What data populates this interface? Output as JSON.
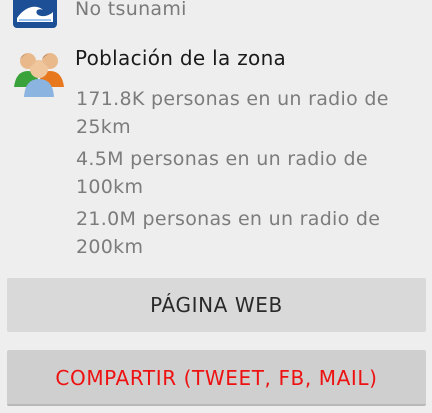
{
  "tsunami": {
    "text": "No tsunami",
    "icon": "tsunami-wave-icon"
  },
  "population": {
    "icon": "people-group-icon",
    "title": "Población de la zona",
    "items": [
      "171.8K personas en un radio de 25km",
      "4.5M personas en un radio de 100km",
      "21.0M personas en un radio de 200km"
    ]
  },
  "buttons": {
    "web_label": "PÁGINA WEB",
    "share_label": "COMPARTIR (TWEET, FB, MAIL)",
    "share_color": "#ee1111"
  }
}
